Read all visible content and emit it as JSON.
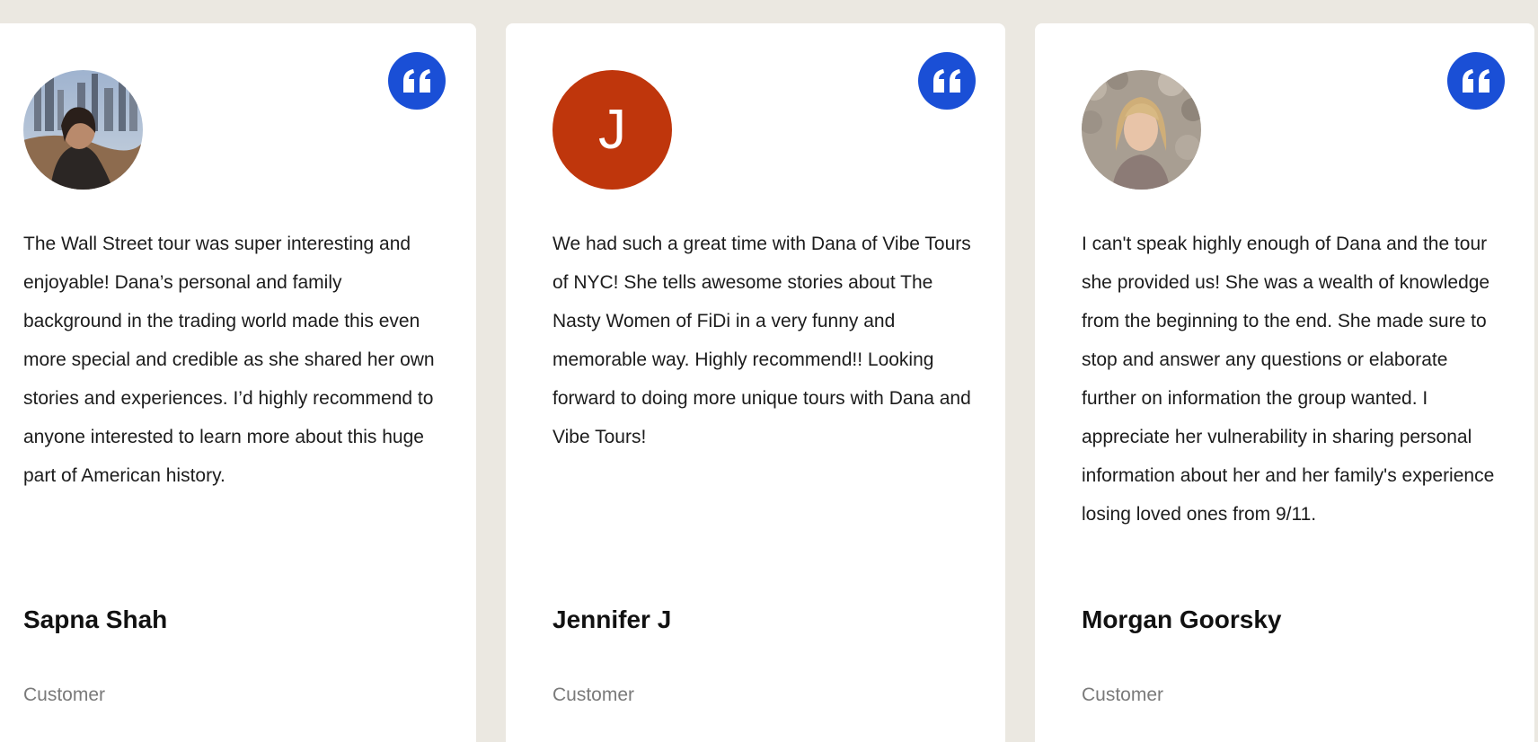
{
  "colors": {
    "page_background": "#ebe8e1",
    "card_background": "#ffffff",
    "quote_badge": "#1a4fd6",
    "avatar_letter_bg": "#bf360c",
    "role_text": "#7a7a7a"
  },
  "testimonials": [
    {
      "avatar_type": "photo",
      "text": "The Wall Street tour was super interesting and enjoyable! Dana’s personal and family background in the trading world made this even more special and credible as she shared her own stories and experiences. I’d highly recommend to anyone interested to learn more about this huge part of American history.",
      "name": "Sapna Shah",
      "role": "Customer",
      "icon": "quote-icon"
    },
    {
      "avatar_type": "letter",
      "avatar_letter": "J",
      "text": "We had such a great time with Dana of Vibe Tours of NYC! She tells awesome stories about The Nasty Women of FiDi in a very funny and memorable way. Highly recommend!! Looking forward to doing more unique tours with Dana and Vibe Tours!",
      "name": "Jennifer J",
      "role": "Customer",
      "icon": "quote-icon"
    },
    {
      "avatar_type": "photo",
      "text": "I can't speak highly enough of Dana and the tour she provided us! She was a wealth of knowledge from the beginning to the end. She made sure to stop and answer any questions or elaborate further on information the group wanted. I appreciate her vulnerability in sharing personal information about her and her family's experience losing loved ones from 9/11.",
      "name": "Morgan Goorsky",
      "role": "Customer",
      "icon": "quote-icon"
    }
  ]
}
